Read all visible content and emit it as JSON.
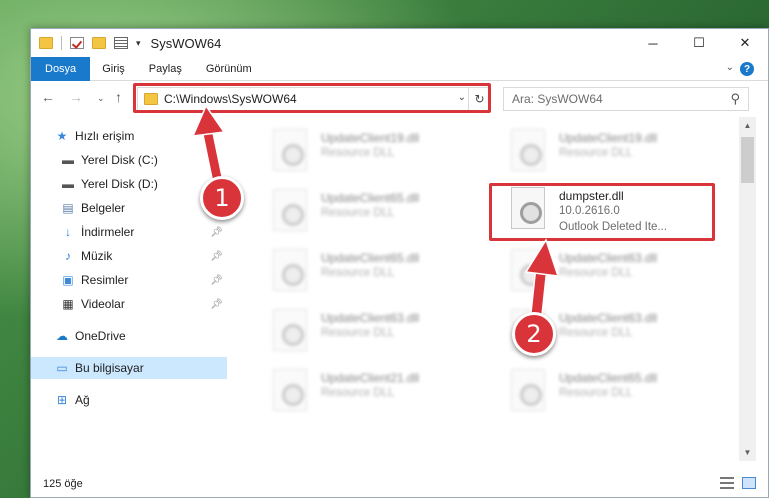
{
  "window": {
    "title": "SysWOW64",
    "controls": {
      "minimize": "─",
      "maximize": "☐",
      "close": "✕"
    }
  },
  "ribbon": {
    "tabs": [
      "Dosya",
      "Giriş",
      "Paylaş",
      "Görünüm"
    ],
    "help": "?"
  },
  "address": {
    "path": "C:\\Windows\\SysWOW64",
    "search_placeholder": "Ara: SysWOW64"
  },
  "sidebar": {
    "quick_access": "Hızlı erişim",
    "items": [
      {
        "label": "Yerel Disk (C:)",
        "icon": "drive-icon"
      },
      {
        "label": "Yerel Disk (D:)",
        "icon": "drive-icon"
      },
      {
        "label": "Belgeler",
        "icon": "documents-icon"
      },
      {
        "label": "İndirmeler",
        "icon": "downloads-icon"
      },
      {
        "label": "Müzik",
        "icon": "music-icon"
      },
      {
        "label": "Resimler",
        "icon": "pictures-icon"
      },
      {
        "label": "Videolar",
        "icon": "videos-icon"
      }
    ],
    "onedrive": "OneDrive",
    "this_pc": "Bu bilgisayar",
    "network": "Ağ"
  },
  "files": {
    "left": [
      {
        "name": "UpdateClient19.dll",
        "type": "Resource DLL"
      },
      {
        "name": "UpdateClient65.dll",
        "type": "Resource DLL"
      },
      {
        "name": "UpdateClient65.dll",
        "type": "Resource DLL"
      },
      {
        "name": "UpdateClient63.dll",
        "type": "Resource DLL"
      },
      {
        "name": "UpdateClient21.dll",
        "type": "Resource DLL"
      }
    ],
    "right": [
      {
        "name": "UpdateClient19.dll",
        "type": "Resource DLL"
      },
      {
        "name": "UpdateClient63.dll",
        "type": "Resource DLL"
      },
      {
        "name": "UpdateClient63.dll",
        "type": "Resource DLL"
      },
      {
        "name": "UpdateClient65.dll",
        "type": "Resource DLL"
      }
    ],
    "highlighted": {
      "name": "dumpster.dll",
      "version": "10.0.2616.0",
      "description": "Outlook Deleted Ite..."
    }
  },
  "status": {
    "count": "125 öğe"
  },
  "callouts": [
    "1",
    "2"
  ],
  "colors": {
    "accent": "#1979ca",
    "callout": "#d9343a",
    "selection": "#cce8ff"
  }
}
